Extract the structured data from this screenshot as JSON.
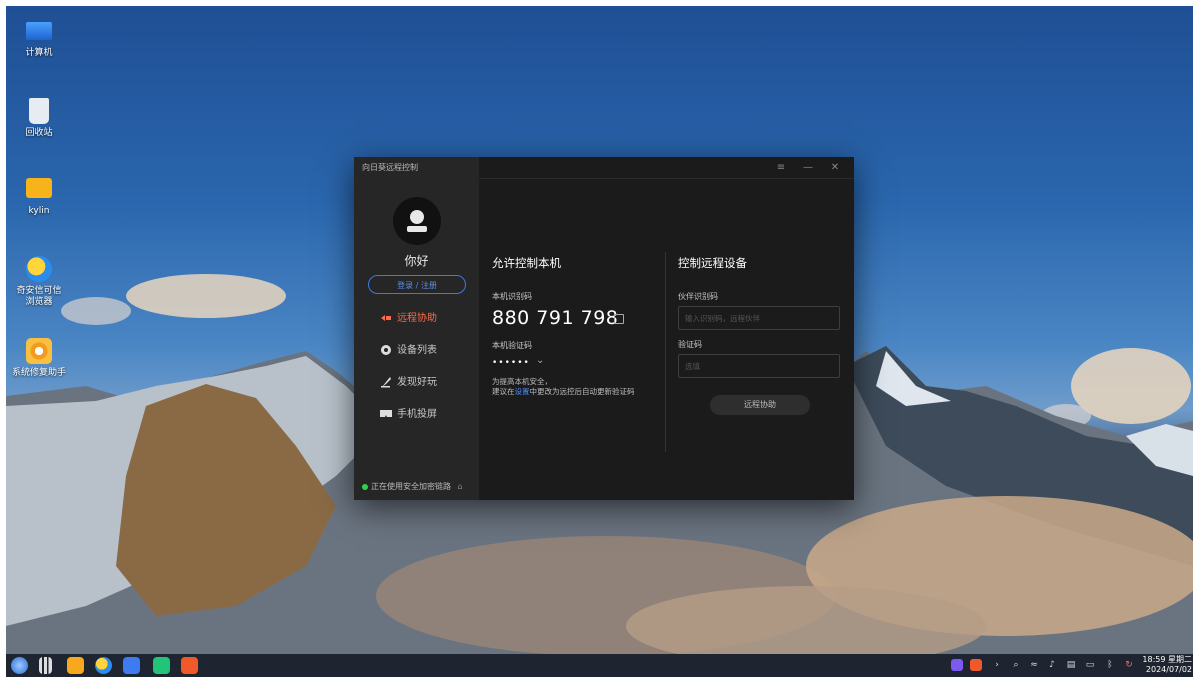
{
  "desktop": {
    "icons": [
      {
        "label": "计算机",
        "icon": "computer-icon"
      },
      {
        "label": "回收站",
        "icon": "trash-icon"
      },
      {
        "label": "kylin",
        "icon": "folder-icon"
      },
      {
        "label": "奇安信可信浏览器",
        "icon": "browser-icon"
      },
      {
        "label": "系统修复助手",
        "icon": "repair-icon"
      }
    ]
  },
  "window": {
    "title": "向日葵远程控制",
    "controls": {
      "menu": "≡",
      "minimize": "—",
      "close": "✕"
    },
    "sidebar": {
      "greeting": "你好",
      "login_label": "登录 / 注册",
      "nav": [
        {
          "label": "远程协助",
          "icon": "remote-assist-icon",
          "active": true
        },
        {
          "label": "设备列表",
          "icon": "device-list-icon",
          "active": false
        },
        {
          "label": "发现好玩",
          "icon": "discover-icon",
          "active": false
        },
        {
          "label": "手机投屏",
          "icon": "screen-cast-icon",
          "active": false
        }
      ],
      "secure_text": "正在使用安全加密链路"
    },
    "allow": {
      "heading": "允许控制本机",
      "id_label": "本机识别码",
      "id_value": "880 791 798",
      "code_label": "本机验证码",
      "code_value": "••••••",
      "hint_line1": "为提高本机安全，",
      "hint_line2_prefix": "建议在",
      "hint_link": "设置",
      "hint_line2_suffix": "中更改为远控后自动更新验证码"
    },
    "control": {
      "heading": "控制远程设备",
      "partner_label": "伙伴识别码",
      "partner_placeholder": "输入识别码，远程伙伴",
      "code_label": "验证码",
      "code_placeholder": "选填",
      "connect_label": "远程协助"
    }
  },
  "taskbar": {
    "apps": [
      "kylin-start-icon",
      "multitask-icon",
      "file-manager-icon",
      "browser-icon",
      "wps-icon",
      "store-icon",
      "sunlogin-icon"
    ],
    "clock_time": "18:59 星期二",
    "clock_date": "2024/07/02"
  },
  "colors": {
    "accent": "#ff6a4a",
    "link": "#3f78e0",
    "secure": "#2fd14a"
  }
}
